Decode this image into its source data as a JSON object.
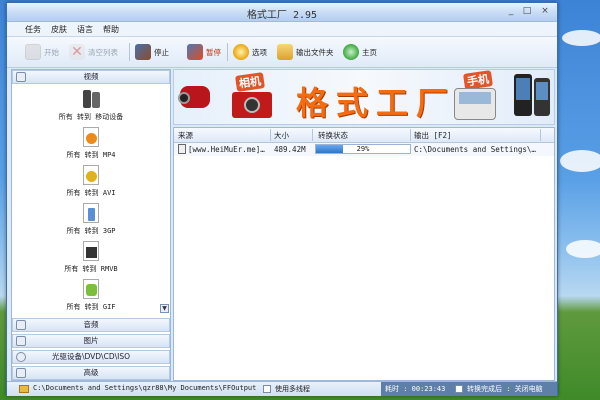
{
  "window": {
    "title": "格式工厂 2.95",
    "min": "_",
    "max": "□",
    "close": "×"
  },
  "menu": [
    "任务",
    "皮肤",
    "语言",
    "帮助"
  ],
  "toolbar": {
    "items": [
      {
        "label": "开始",
        "icon": "start-icon",
        "color": "#c9c9c9",
        "enabled": false
      },
      {
        "label": "清空列表",
        "icon": "clear-list-icon",
        "color": "#d04040",
        "enabled": false
      },
      {
        "label": "停止",
        "icon": "stop-icon",
        "color": "#7a4a2e",
        "enabled": true
      },
      {
        "label": "暂停",
        "icon": "pause-icon",
        "color": "#e44b1e",
        "enabled": true
      },
      {
        "label": "选项",
        "icon": "options-icon",
        "color": "#f0b020",
        "enabled": true
      },
      {
        "label": "输出文件夹",
        "icon": "output-folder-icon",
        "color": "#e9b940",
        "enabled": true
      },
      {
        "label": "主页",
        "icon": "homepage-icon",
        "color": "#3fa83f",
        "enabled": true
      }
    ]
  },
  "left_panel": {
    "video_header": "视频",
    "formats": [
      {
        "label": "所有 转到 移动设备",
        "icon": "mobile-device-icon",
        "color": "#444444"
      },
      {
        "label": "所有 转到 MP4",
        "icon": "mp4-icon",
        "color": "#e98a1a"
      },
      {
        "label": "所有 转到 AVI",
        "icon": "avi-icon",
        "color": "#e0b21c"
      },
      {
        "label": "所有 转到 3GP",
        "icon": "3gp-icon",
        "color": "#5b8fd3"
      },
      {
        "label": "所有 转到 RMVB",
        "icon": "rmvb-icon",
        "color": "#333333"
      },
      {
        "label": "所有 转到 GIF",
        "icon": "gif-icon",
        "color": "#7bbf3a"
      }
    ],
    "categories": [
      {
        "label": "音频",
        "icon": "audio-icon"
      },
      {
        "label": "图片",
        "icon": "picture-icon"
      },
      {
        "label": "光驱设备\\DVD\\CD\\ISO",
        "icon": "disc-icon"
      },
      {
        "label": "高级",
        "icon": "advanced-icon"
      }
    ]
  },
  "banner": {
    "camera_tag": "相机",
    "title": "格式工厂",
    "phone_tag": "手机"
  },
  "task_list": {
    "columns": [
      "来源",
      "大小",
      "转换状态",
      "输出 [F2]"
    ],
    "rows": [
      {
        "source": "[www.HeiMuEr.me]…",
        "size": "489.42M",
        "progress": 29,
        "progress_text": "29%",
        "output": "C:\\Documents and Settings\\…"
      }
    ]
  },
  "status_bar": {
    "output_path": "C:\\Documents and Settings\\qzr88\\My Documents\\FFOutput",
    "multithread": "使用多线程",
    "elapsed": "耗时 : 00:23:43",
    "after_convert": "转换完成后 : 关闭电脑"
  }
}
